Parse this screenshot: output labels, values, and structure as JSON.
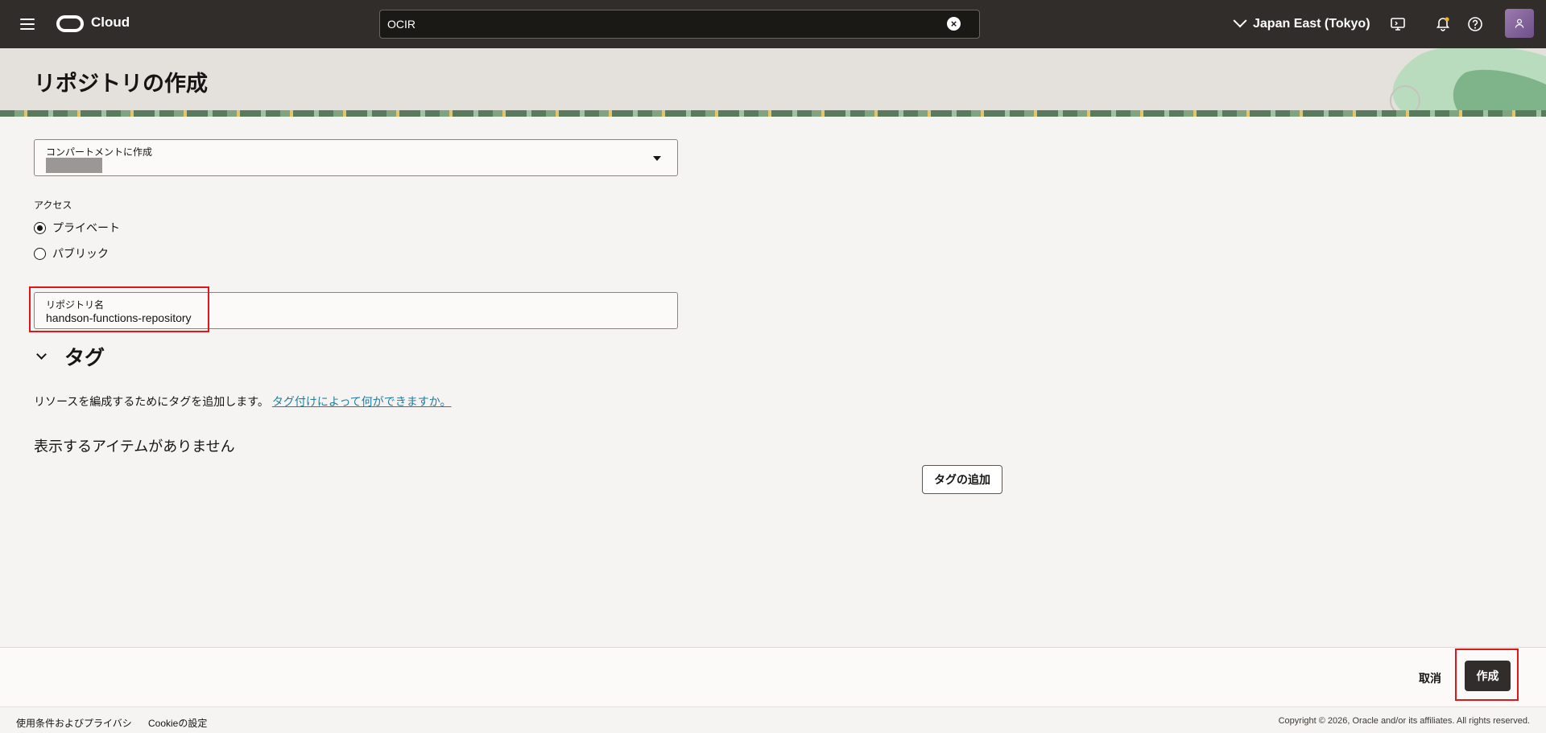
{
  "topbar": {
    "brand": "Cloud",
    "search_value": "OCIR",
    "region": "Japan East (Tokyo)"
  },
  "page": {
    "title": "リポジトリの作成"
  },
  "form": {
    "compartment_label": "コンパートメントに作成",
    "access_label": "アクセス",
    "access_options": [
      {
        "label": "プライベート",
        "checked": true
      },
      {
        "label": "パブリック",
        "checked": false
      }
    ],
    "repo_name_label": "リポジトリ名",
    "repo_name_value": "handson-functions-repository"
  },
  "tags": {
    "title": "タグ",
    "description": "リソースを編成するためにタグを追加します。",
    "link": "タグ付けによって何ができますか。",
    "empty": "表示するアイテムがありません",
    "add_button": "タグの追加"
  },
  "actions": {
    "cancel": "取消",
    "create": "作成"
  },
  "footer": {
    "terms": "使用条件およびプライバシ",
    "cookie": "Cookieの設定",
    "copyright": "Copyright © 2026, Oracle and/or its affiliates. All rights reserved."
  },
  "colors": {
    "topbar": "#312d2a",
    "highlight": "#e0161d",
    "link": "#227e9e"
  }
}
